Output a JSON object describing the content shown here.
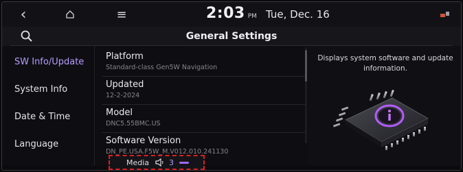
{
  "status_bar": {
    "time": "2:03",
    "ampm": "PM",
    "date": "Tue, Dec. 16"
  },
  "header": {
    "title": "General Settings"
  },
  "nav": {
    "items": [
      {
        "label": "SW Info/Update",
        "active": true
      },
      {
        "label": "System Info",
        "active": false
      },
      {
        "label": "Date & Time",
        "active": false
      },
      {
        "label": "Language",
        "active": false
      }
    ]
  },
  "list": {
    "rows": [
      {
        "label": "Platform",
        "value": "Standard-class Gen5W Navigation"
      },
      {
        "label": "Updated",
        "value": "12-2-2024"
      },
      {
        "label": "Model",
        "value": "DNC5.55BMC.US"
      },
      {
        "label": "Software Version",
        "value": "DN_PE.USA.F5W_M.V012.010.241130"
      }
    ]
  },
  "panel": {
    "description": "Displays system software and update information."
  },
  "media_bar": {
    "label": "Media",
    "volume": "3",
    "accent_color": "#a26bff"
  },
  "icons": [
    "back-arrow-icon",
    "home-icon",
    "menu-icon",
    "search-icon",
    "speaker-icon",
    "signal-icon",
    "info-chip-icon"
  ],
  "colors": {
    "active_nav": "#b79bff",
    "highlight_border": "#d82020"
  }
}
